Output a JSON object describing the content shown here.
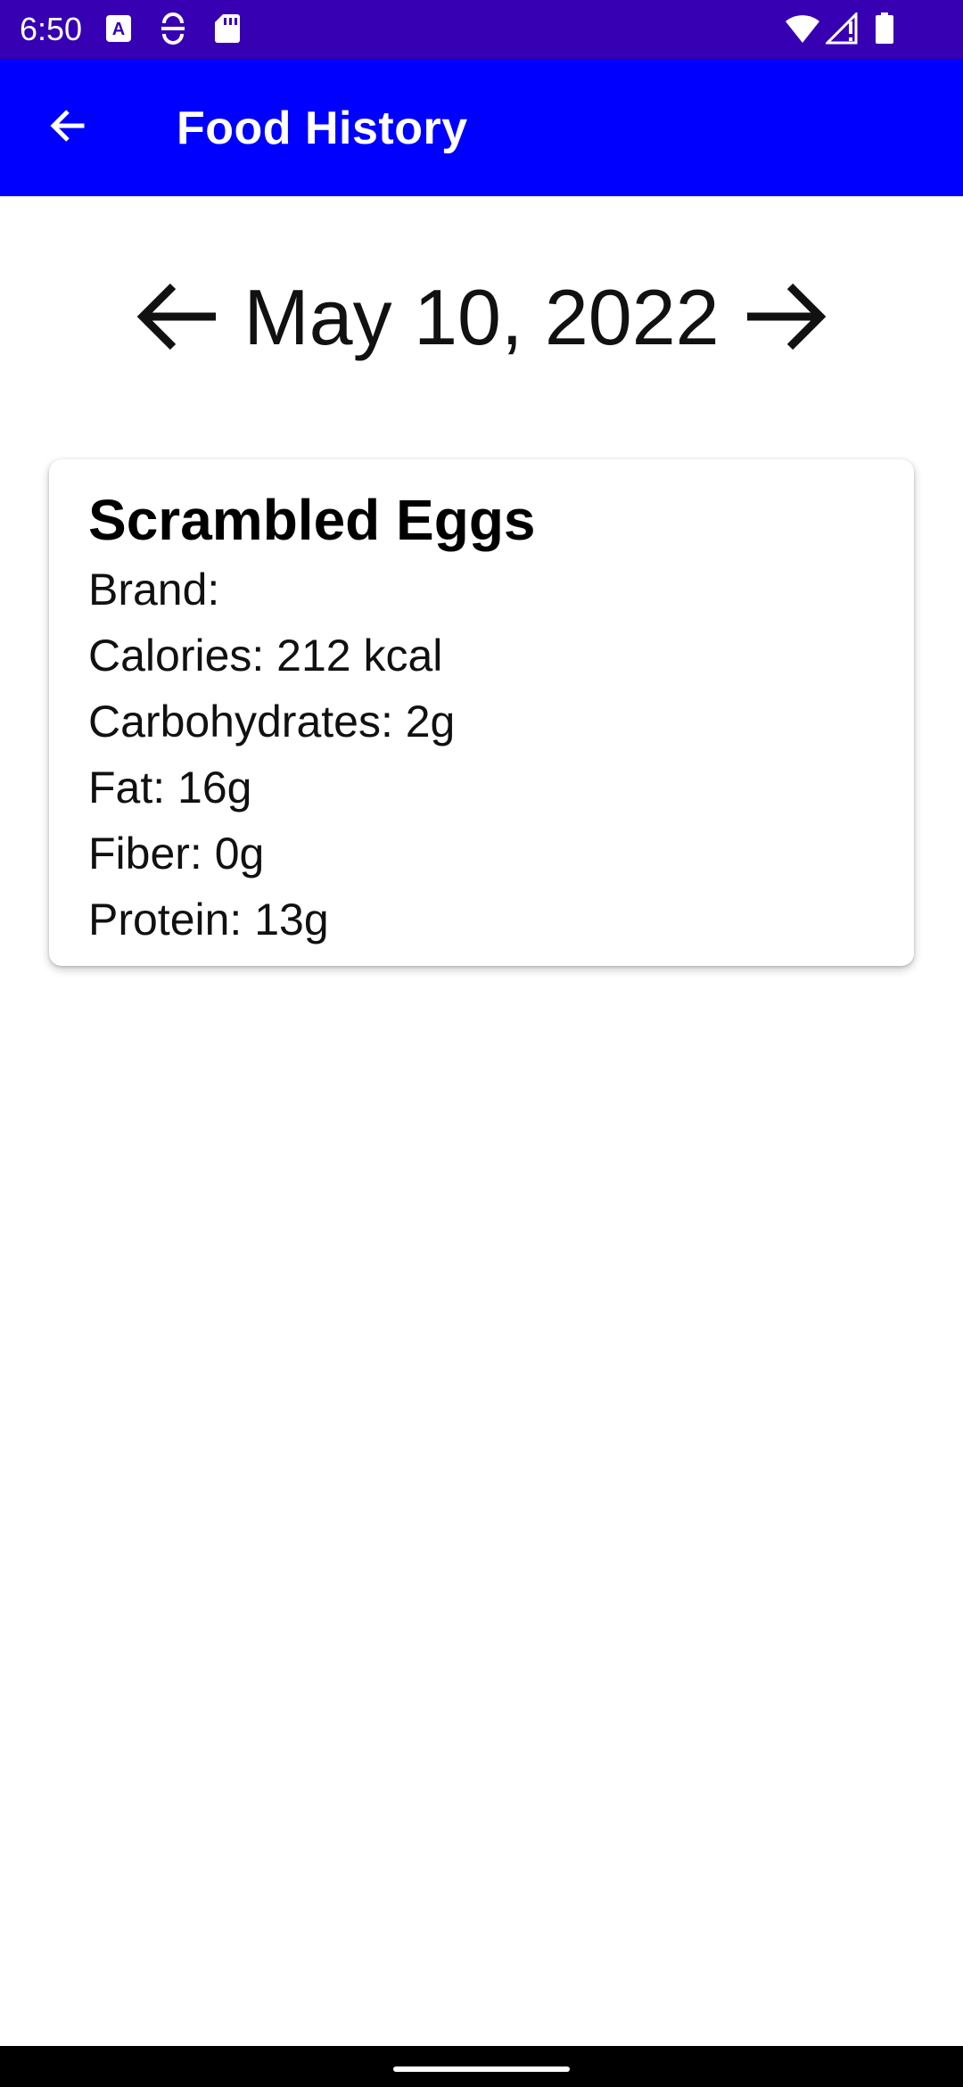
{
  "status_bar": {
    "time": "6:50",
    "icons": [
      "font-a-icon",
      "vpn-icon",
      "sd-card-icon",
      "wifi-icon",
      "signal-icon",
      "battery-icon"
    ],
    "background": "#3700b3"
  },
  "app_bar": {
    "title": "Food History",
    "back_icon": "arrow-left-icon",
    "background": "#0000ff"
  },
  "date_nav": {
    "date": "May 10, 2022",
    "prev_icon": "arrow-left-icon",
    "next_icon": "arrow-right-icon"
  },
  "food_entries": [
    {
      "name": "Scrambled Eggs",
      "brand": "Brand:",
      "calories": "Calories: 212 kcal",
      "carbohydrates": "Carbohydrates: 2g",
      "fat": "Fat: 16g",
      "fiber": "Fiber: 0g",
      "protein": "Protein: 13g"
    }
  ]
}
